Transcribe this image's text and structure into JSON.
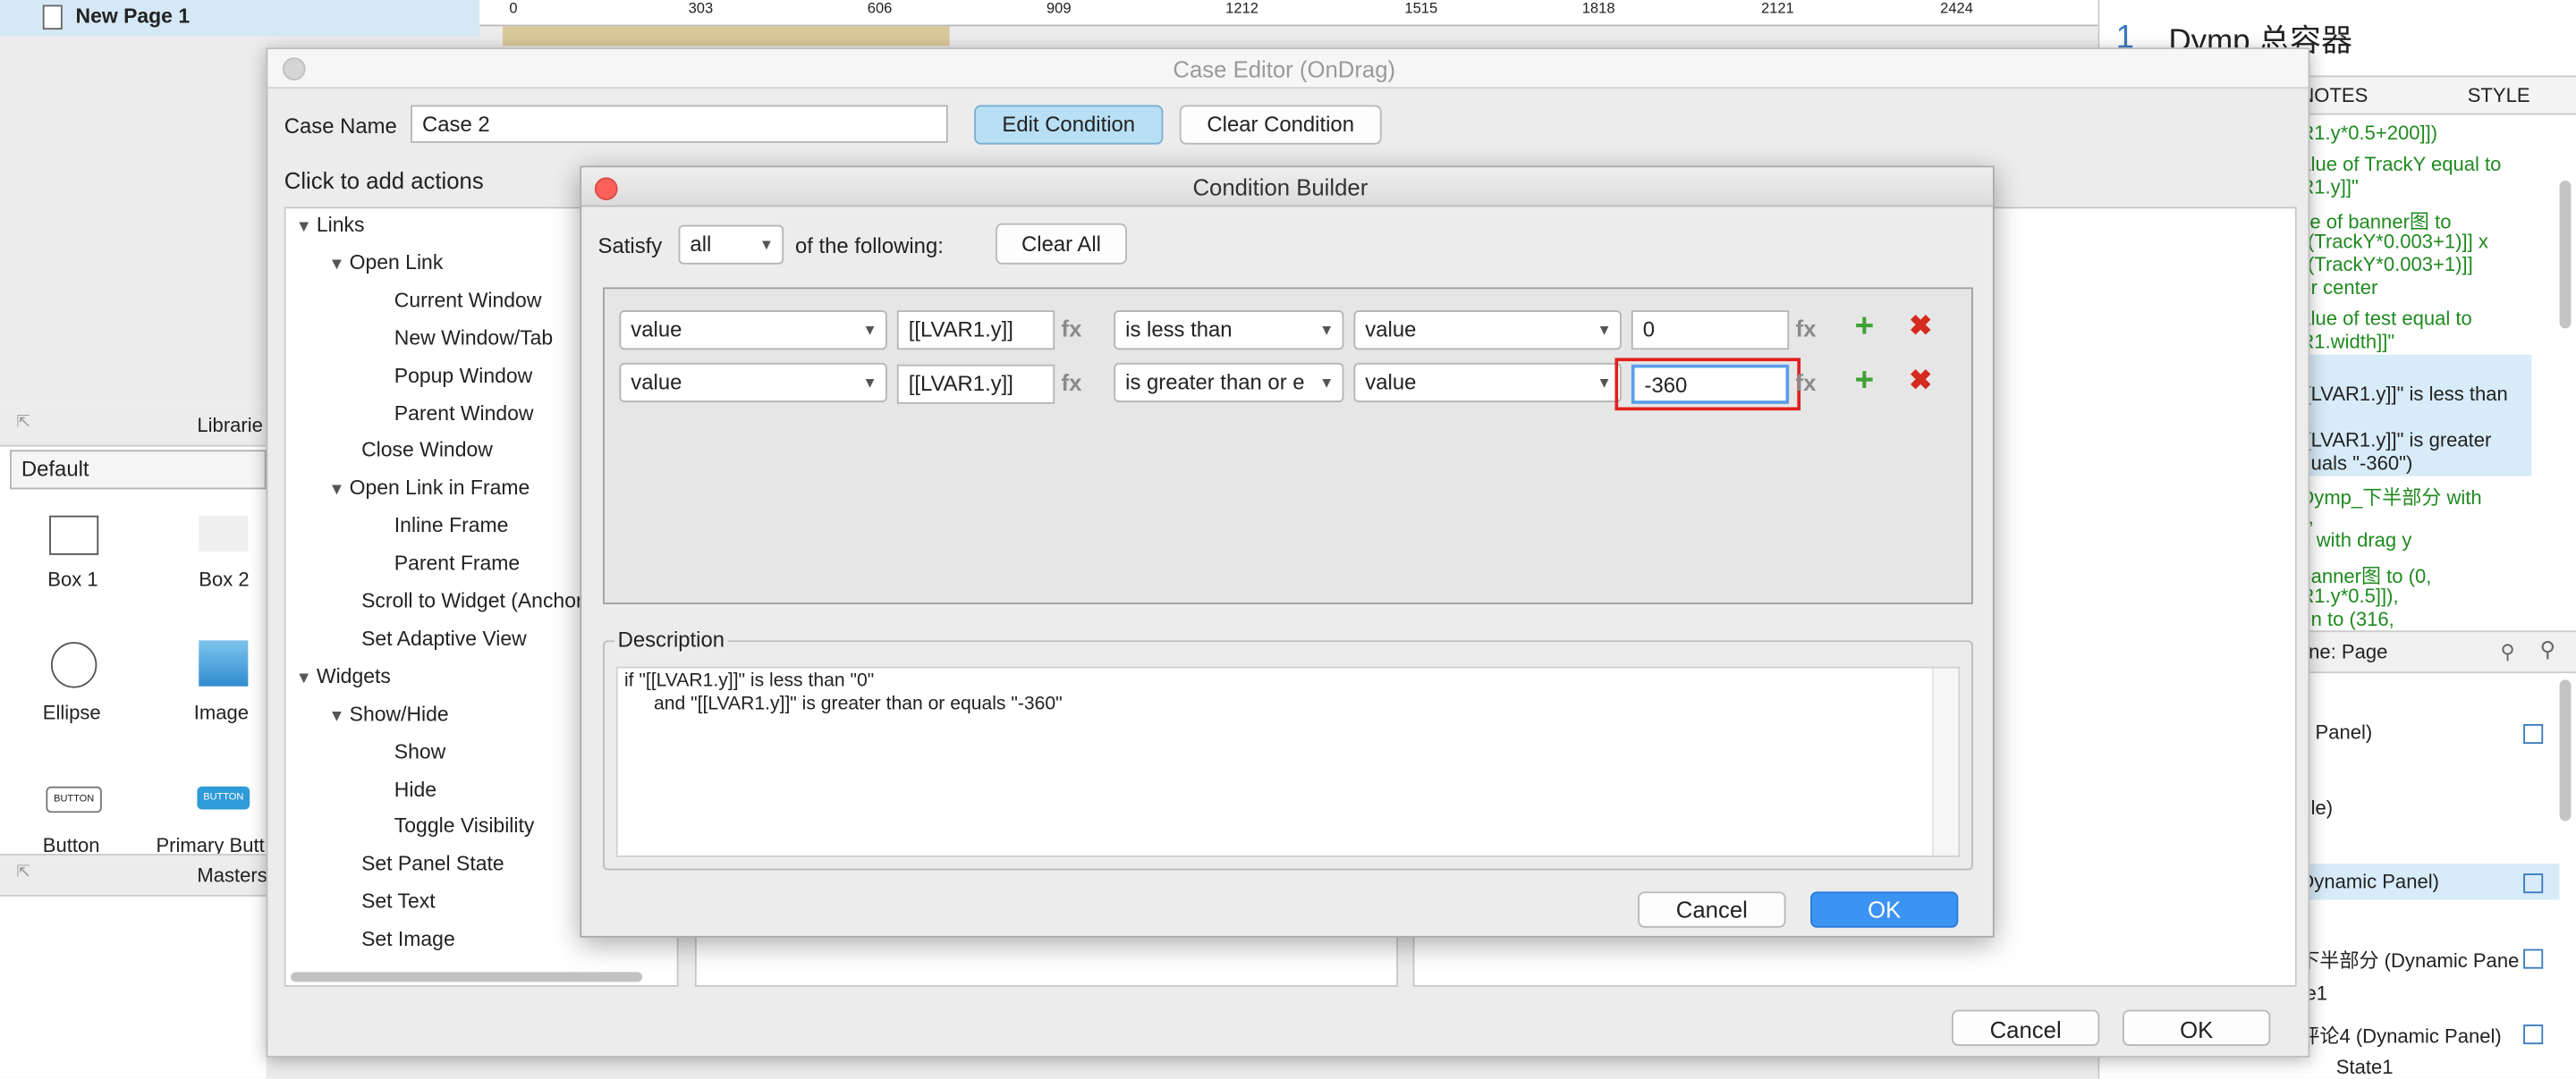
{
  "top_left_tab": "New Page 1",
  "ruler": [
    "0",
    "303",
    "606",
    "909",
    "1212",
    "1515",
    "1818",
    "2121",
    "2424"
  ],
  "right_panel": {
    "number": "1",
    "title": "Dymp 总容器",
    "tabs": [
      "NOTES",
      "STYLE"
    ],
    "lines": [
      "R1.y*0.5+200]])",
      "alue of TrackY equal to",
      "R1.y]]\"",
      "ze of banner图 to",
      "*(TrackY*0.003+1)]] x",
      "*(TrackY*0.003+1)]]",
      "or center",
      "alue of test equal to",
      "R1.width]]\"",
      "[[LVAR1.y]]\" is less than",
      "[[LVAR1.y]]\" is greater",
      "quals \"-360\")",
      "Dymp_下半部分 with",
      "y,",
      "e with drag y",
      "banner图 to (0,",
      "R1.y*0.5]]),",
      "on to (316,"
    ],
    "outline_title": "line: Page",
    "outline_items": [
      "c Panel)",
      "gle)",
      "Dynamic Panel)",
      "下半部分 (Dynamic Pane",
      "te1",
      "评论4 (Dynamic Panel)",
      "State1"
    ]
  },
  "libraries": {
    "title": "Librarie",
    "dropdown": "Default",
    "items": [
      "Box 1",
      "Box 2",
      "Ellipse",
      "Image",
      "Button",
      "Primary Butt"
    ],
    "button_caption": "BUTTON",
    "masters_title": "Masters"
  },
  "case_editor": {
    "title": "Case Editor (OnDrag)",
    "case_name_label": "Case Name",
    "case_name_value": "Case 2",
    "edit_condition": "Edit Condition",
    "clear_condition": "Clear Condition",
    "add_actions_label": "Click to add actions",
    "tree": [
      {
        "label": "Links",
        "level": 0,
        "arrow": true
      },
      {
        "label": "Open Link",
        "level": 1,
        "arrow": true
      },
      {
        "label": "Current Window",
        "level": 2
      },
      {
        "label": "New Window/Tab",
        "level": 2
      },
      {
        "label": "Popup Window",
        "level": 2
      },
      {
        "label": "Parent Window",
        "level": 2
      },
      {
        "label": "Close Window",
        "level": 1
      },
      {
        "label": "Open Link in Frame",
        "level": 1,
        "arrow": true
      },
      {
        "label": "Inline Frame",
        "level": 2
      },
      {
        "label": "Parent Frame",
        "level": 2
      },
      {
        "label": "Scroll to Widget (Anchor",
        "level": 1
      },
      {
        "label": "Set Adaptive View",
        "level": 1
      },
      {
        "label": "Widgets",
        "level": 0,
        "arrow": true
      },
      {
        "label": "Show/Hide",
        "level": 1,
        "arrow": true
      },
      {
        "label": "Show",
        "level": 2
      },
      {
        "label": "Hide",
        "level": 2
      },
      {
        "label": "Toggle Visibility",
        "level": 2
      },
      {
        "label": "Set Panel State",
        "level": 1
      },
      {
        "label": "Set Text",
        "level": 1
      },
      {
        "label": "Set Image",
        "level": 1
      }
    ],
    "cancel": "Cancel",
    "ok": "OK"
  },
  "condition_builder": {
    "title": "Condition Builder",
    "satisfy_label": "Satisfy",
    "satisfy_value": "all",
    "following_label": "of the following:",
    "clear_all": "Clear All",
    "rows": [
      {
        "left_type": "value",
        "left_value": "[[LVAR1.y]]",
        "operator": "is less than",
        "right_type": "value",
        "right_value": "0"
      },
      {
        "left_type": "value",
        "left_value": "[[LVAR1.y]]",
        "operator": "is greater than or e",
        "right_type": "value",
        "right_value": "-360"
      }
    ],
    "fx": "fx",
    "description_label": "Description",
    "description_line1": "if \"[[LVAR1.y]]\" is less than \"0\"",
    "description_line2": "and \"[[LVAR1.y]]\" is greater than or equals \"-360\"",
    "cancel": "Cancel",
    "ok": "OK",
    "ok_color": "#2f8cf0",
    "highlight_color": "#e02020"
  }
}
